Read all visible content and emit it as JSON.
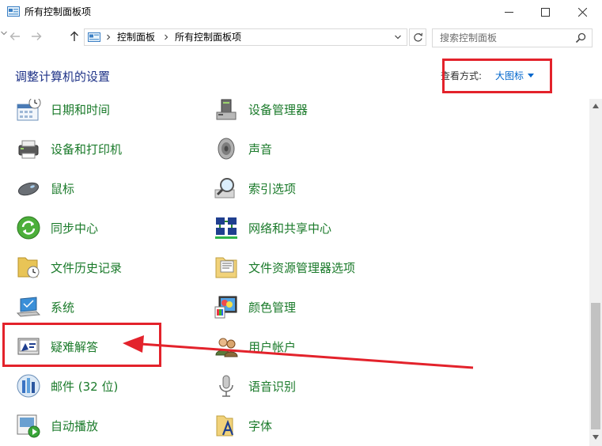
{
  "window": {
    "title": "所有控制面板项"
  },
  "address": {
    "crumbs": [
      "控制面板",
      "所有控制面板项"
    ]
  },
  "search": {
    "placeholder": "搜索控制面板"
  },
  "header": {
    "title": "调整计算机的设置",
    "view_by_label": "查看方式:",
    "view_by_value": "大图标"
  },
  "items": [
    {
      "label": "日期和时间",
      "icon": "calendar-clock-icon"
    },
    {
      "label": "设备管理器",
      "icon": "device-manager-icon"
    },
    {
      "label": "设备和打印机",
      "icon": "printer-icon"
    },
    {
      "label": "声音",
      "icon": "speaker-icon"
    },
    {
      "label": "鼠标",
      "icon": "mouse-icon"
    },
    {
      "label": "索引选项",
      "icon": "magnifier-icon"
    },
    {
      "label": "同步中心",
      "icon": "sync-icon"
    },
    {
      "label": "网络和共享中心",
      "icon": "network-icon"
    },
    {
      "label": "文件历史记录",
      "icon": "file-history-icon"
    },
    {
      "label": "文件资源管理器选项",
      "icon": "folder-options-icon"
    },
    {
      "label": "系统",
      "icon": "laptop-icon"
    },
    {
      "label": "颜色管理",
      "icon": "color-management-icon"
    },
    {
      "label": "疑难解答",
      "icon": "troubleshooting-icon"
    },
    {
      "label": "用户帐户",
      "icon": "user-accounts-icon"
    },
    {
      "label": "邮件 (32 位)",
      "icon": "mail-icon"
    },
    {
      "label": "语音识别",
      "icon": "microphone-icon"
    },
    {
      "label": "自动播放",
      "icon": "autoplay-icon"
    },
    {
      "label": "字体",
      "icon": "font-folder-icon"
    }
  ],
  "colors": {
    "link_green": "#1a7a2a",
    "title_blue": "#1e3287",
    "accent_blue": "#0066cc",
    "annotation_red": "#e3222b"
  }
}
